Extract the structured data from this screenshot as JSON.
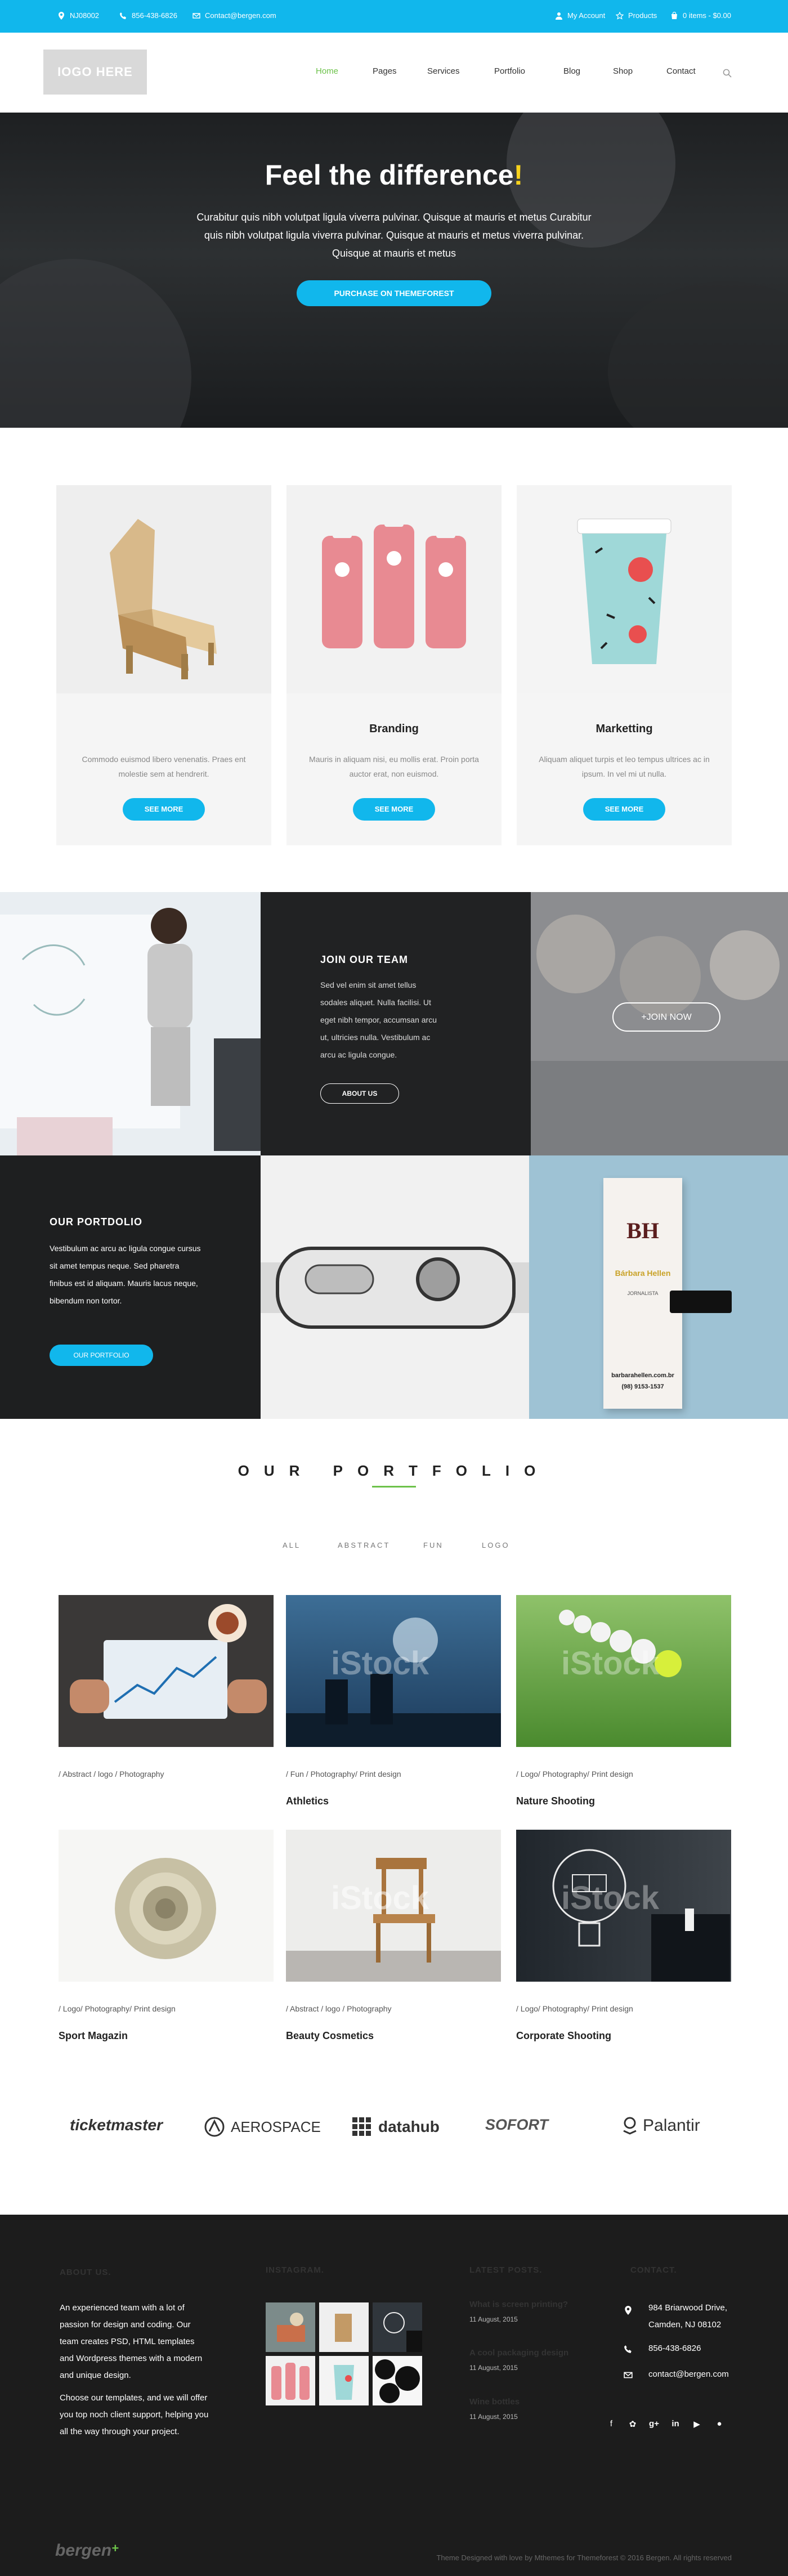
{
  "topbar": {
    "location": "NJ08002",
    "phone": "856-438-6826",
    "email": "Contact@bergen.com",
    "account": "My Account",
    "products": "Products",
    "cart": "0 items - $0.00"
  },
  "header": {
    "logo": "IOGO HERE",
    "nav": [
      "Home",
      "Pages",
      "Services",
      "Portfolio",
      "Blog",
      "Shop",
      "Contact"
    ],
    "active_nav": "Home"
  },
  "hero": {
    "title": "Feel the difference",
    "title_mark": "!",
    "text": "Curabitur quis nibh volutpat ligula viverra pulvinar. Quisque at mauris et metus Curabitur quis nibh volutpat ligula viverra pulvinar. Quisque at mauris et metus viverra pulvinar. Quisque at mauris et metus",
    "button": "PURCHASE ON THEMEFOREST"
  },
  "services": [
    {
      "title": "",
      "text": "Commodo euismod libero venenatis. Praes ent molestie sem at hendrerit.",
      "button": "SEE MORE"
    },
    {
      "title": "Branding",
      "text": "Mauris in aliquam nisi, eu mollis erat. Proin porta auctor erat, non euismod.",
      "button": "SEE MORE"
    },
    {
      "title": "Marketting",
      "text": "Aliquam aliquet turpis et leo tempus ultrices ac in ipsum. In vel mi ut nulla.",
      "button": "SEE MORE"
    }
  ],
  "join": {
    "title": "JOIN OUR TEAM",
    "text": "Sed vel enim sit amet tellus sodales aliquet. Nulla facilisi. Ut eget nibh tempor, accumsan arcu ut, ultricies nulla. Vestibulum ac arcu ac ligula congue.",
    "button": "ABOUT US",
    "join_button": "+JOIN NOW"
  },
  "portdolio": {
    "title": "OUR PORTDOLIO",
    "text": "Vestibulum ac arcu ac ligula congue cursus sit amet tempus neque. Sed pharetra finibus est id aliquam. Mauris lacus neque, bibendum non tortor.",
    "button": "OUR PORTFOLIO"
  },
  "card": {
    "initials": "BH",
    "name": "Bárbara Hellen",
    "role": "JORNALISTA",
    "site": "barbarahellen.com.br",
    "phone": "(98) 9153-1537"
  },
  "portfolio": {
    "title": "OUR PORTFOLIO",
    "filters": [
      "ALL",
      "ABSTRACT",
      "FUN",
      "LOGO"
    ],
    "watermark": "iStock",
    "items": [
      {
        "category": "/ Abstract / logo / Photography",
        "title": ""
      },
      {
        "category": "/ Fun / Photography/ Print design",
        "title": "Athletics"
      },
      {
        "category": "/ Logo/ Photography/ Print design",
        "title": "Nature Shooting"
      },
      {
        "category": "/ Logo/ Photography/ Print design",
        "title": "Sport Magazin"
      },
      {
        "category": "/ Abstract / logo / Photography",
        "title": "Beauty Cosmetics"
      },
      {
        "category": "/ Logo/ Photography/ Print design",
        "title": "Corporate Shooting"
      }
    ]
  },
  "clients": [
    "ticketmaster",
    "AEROSPACE",
    "datahub",
    "SOFORT",
    "Palantir"
  ],
  "footer": {
    "about_title": "ABOUT US.",
    "about_text_1": "An experienced team with a lot of passion for design and coding. Our team creates PSD, HTML templates and Wordpress themes with a modern and unique design.",
    "about_text_2": "Choose our templates, and we will offer you top noch client support, helping you all the way through your project.",
    "instagram_title": "INSTAGRAM.",
    "posts_title": "LATEST POSTS.",
    "posts": [
      {
        "title": "What is screen printing?",
        "date": "11 August, 2015"
      },
      {
        "title": "A cool packaging design",
        "date": "11 August, 2015"
      },
      {
        "title": "Wine bottles",
        "date": "11 August, 2015"
      }
    ],
    "contact_title": "CONTACT.",
    "address": "984 Briarwood Drive, Camden, NJ 08102",
    "phone": "856-438-6826",
    "email": "contact@bergen.com",
    "brand": "bergen",
    "copyright": "Theme Designed with love by Mthemes for Themeforest © 2016 Bergen. All rights reserved"
  },
  "colors": {
    "accent": "#11b7ec",
    "green": "#6cc24a",
    "dark": "#1c1c1c",
    "yellow": "#f7d21c"
  }
}
